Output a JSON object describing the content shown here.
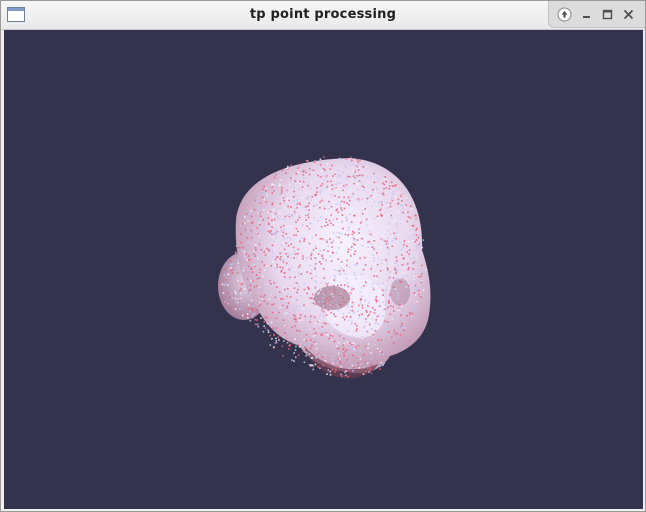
{
  "window": {
    "title": "tp point processing",
    "controls": [
      "up-icon",
      "minimize-icon",
      "maximize-icon",
      "close-icon"
    ]
  },
  "viewport": {
    "background_color": "#34334d",
    "point_colors": [
      "#c8c6f0",
      "#e8607a",
      "#f4f2ff"
    ]
  }
}
